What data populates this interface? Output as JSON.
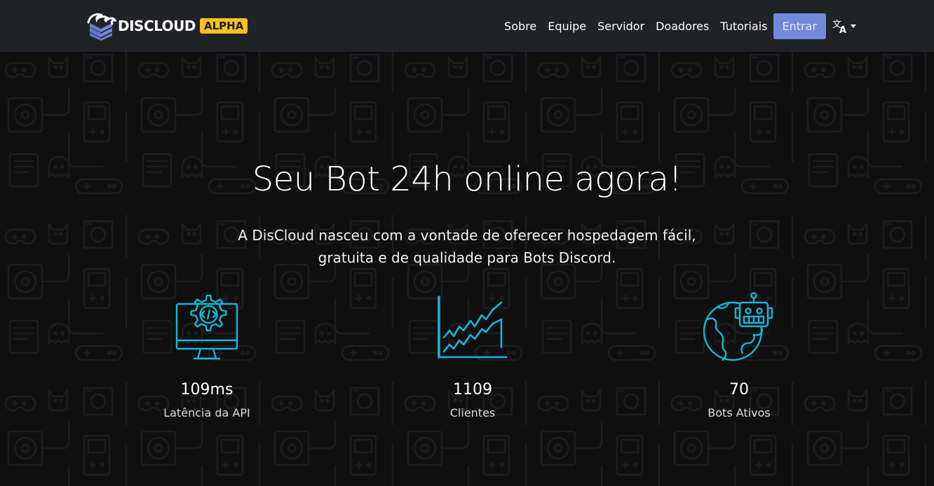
{
  "navbar": {
    "brand_name": "DISCLOUD",
    "brand_badge": "ALPHA",
    "links": [
      "Sobre",
      "Equipe",
      "Servidor",
      "Doadores",
      "Tutoriais"
    ],
    "login_label": "Entrar",
    "language_icon": "translate-icon"
  },
  "hero": {
    "title": "Seu Bot 24h online agora!",
    "subtitle_line1": "A DisCloud nasceu com a vontade de oferecer hospedagem fácil,",
    "subtitle_line2": "gratuita e de qualidade para Bots Discord."
  },
  "stats": [
    {
      "icon": "monitor-code-gear-icon",
      "value": "109ms",
      "label": "Latência da API"
    },
    {
      "icon": "growth-chart-icon",
      "value": "1109",
      "label": "Clientes"
    },
    {
      "icon": "globe-robot-icon",
      "value": "70",
      "label": "Bots Ativos"
    }
  ],
  "colors": {
    "navbar_bg": "#212226",
    "page_bg": "#0f0f10",
    "accent_cyan": "#19b5d6",
    "login_button": "#7289da",
    "badge": "#f6c124"
  }
}
